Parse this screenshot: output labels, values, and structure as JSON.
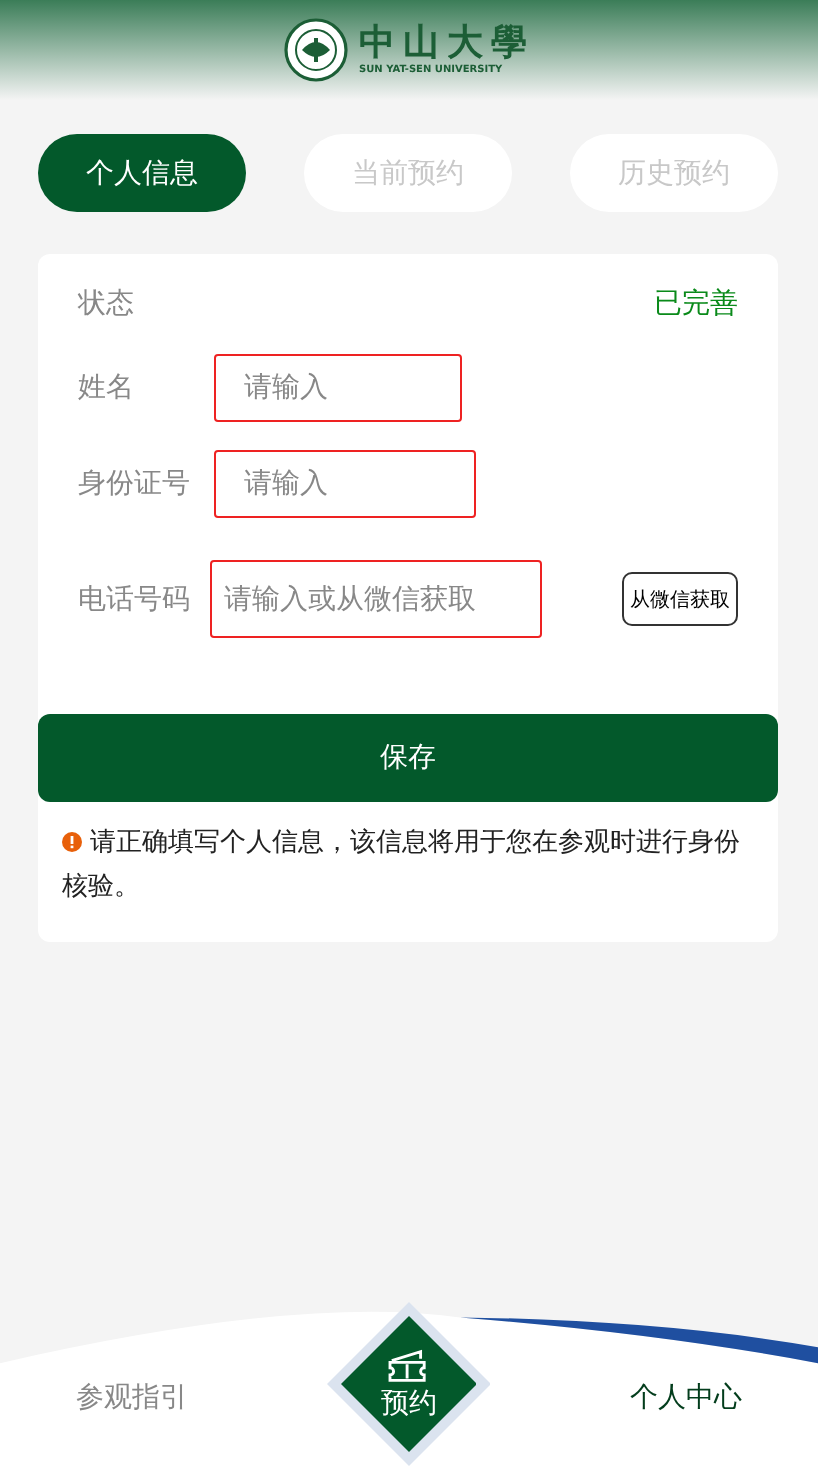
{
  "header": {
    "logo_title": "中山大學",
    "logo_subtitle": "SUN YAT-SEN UNIVERSITY"
  },
  "tabs": [
    {
      "label": "个人信息",
      "selected": true
    },
    {
      "label": "当前预约",
      "selected": false
    },
    {
      "label": "历史预约",
      "selected": false
    }
  ],
  "form": {
    "status_label": "状态",
    "status_value": "已完善",
    "fields": [
      {
        "label": "姓名",
        "placeholder": "请输入",
        "kind": "short"
      },
      {
        "label": "身份证号",
        "placeholder": "请输入",
        "kind": "medium"
      },
      {
        "label": "电话号码",
        "placeholder": "请输入或从微信获取",
        "kind": "phone",
        "action": "从微信获取"
      }
    ],
    "save": "保存",
    "notice": "请正确填写个人信息，该信息将用于您在参观时进行身份核验。"
  },
  "nav": {
    "items": [
      {
        "label": "参观指引",
        "selected": false
      },
      {
        "label": "个人中心",
        "selected": true
      }
    ],
    "center": "预约"
  }
}
